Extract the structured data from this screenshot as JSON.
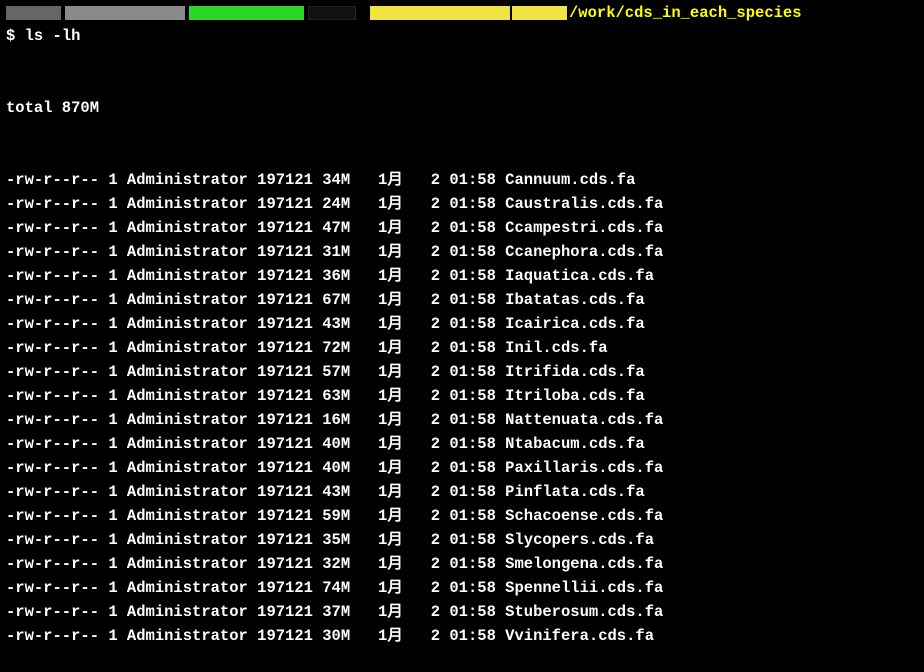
{
  "path_suffix": "/work/cds_in_each_species",
  "prompt": "$ ",
  "command": "ls -lh",
  "total_line": "total 870M",
  "columns": [
    "perms",
    "links",
    "owner",
    "group",
    "size",
    "month",
    "day",
    "time",
    "name"
  ],
  "rows": [
    {
      "perms": "-rw-r--r--",
      "links": "1",
      "owner": "Administrator",
      "group": "197121",
      "size": "34M",
      "month": "1月",
      "day": "2",
      "time": "01:58",
      "name": "Cannuum.cds.fa"
    },
    {
      "perms": "-rw-r--r--",
      "links": "1",
      "owner": "Administrator",
      "group": "197121",
      "size": "24M",
      "month": "1月",
      "day": "2",
      "time": "01:58",
      "name": "Caustralis.cds.fa"
    },
    {
      "perms": "-rw-r--r--",
      "links": "1",
      "owner": "Administrator",
      "group": "197121",
      "size": "47M",
      "month": "1月",
      "day": "2",
      "time": "01:58",
      "name": "Ccampestri.cds.fa"
    },
    {
      "perms": "-rw-r--r--",
      "links": "1",
      "owner": "Administrator",
      "group": "197121",
      "size": "31M",
      "month": "1月",
      "day": "2",
      "time": "01:58",
      "name": "Ccanephora.cds.fa"
    },
    {
      "perms": "-rw-r--r--",
      "links": "1",
      "owner": "Administrator",
      "group": "197121",
      "size": "36M",
      "month": "1月",
      "day": "2",
      "time": "01:58",
      "name": "Iaquatica.cds.fa"
    },
    {
      "perms": "-rw-r--r--",
      "links": "1",
      "owner": "Administrator",
      "group": "197121",
      "size": "67M",
      "month": "1月",
      "day": "2",
      "time": "01:58",
      "name": "Ibatatas.cds.fa"
    },
    {
      "perms": "-rw-r--r--",
      "links": "1",
      "owner": "Administrator",
      "group": "197121",
      "size": "43M",
      "month": "1月",
      "day": "2",
      "time": "01:58",
      "name": "Icairica.cds.fa"
    },
    {
      "perms": "-rw-r--r--",
      "links": "1",
      "owner": "Administrator",
      "group": "197121",
      "size": "72M",
      "month": "1月",
      "day": "2",
      "time": "01:58",
      "name": "Inil.cds.fa"
    },
    {
      "perms": "-rw-r--r--",
      "links": "1",
      "owner": "Administrator",
      "group": "197121",
      "size": "57M",
      "month": "1月",
      "day": "2",
      "time": "01:58",
      "name": "Itrifida.cds.fa"
    },
    {
      "perms": "-rw-r--r--",
      "links": "1",
      "owner": "Administrator",
      "group": "197121",
      "size": "63M",
      "month": "1月",
      "day": "2",
      "time": "01:58",
      "name": "Itriloba.cds.fa"
    },
    {
      "perms": "-rw-r--r--",
      "links": "1",
      "owner": "Administrator",
      "group": "197121",
      "size": "16M",
      "month": "1月",
      "day": "2",
      "time": "01:58",
      "name": "Nattenuata.cds.fa"
    },
    {
      "perms": "-rw-r--r--",
      "links": "1",
      "owner": "Administrator",
      "group": "197121",
      "size": "40M",
      "month": "1月",
      "day": "2",
      "time": "01:58",
      "name": "Ntabacum.cds.fa"
    },
    {
      "perms": "-rw-r--r--",
      "links": "1",
      "owner": "Administrator",
      "group": "197121",
      "size": "40M",
      "month": "1月",
      "day": "2",
      "time": "01:58",
      "name": "Paxillaris.cds.fa"
    },
    {
      "perms": "-rw-r--r--",
      "links": "1",
      "owner": "Administrator",
      "group": "197121",
      "size": "43M",
      "month": "1月",
      "day": "2",
      "time": "01:58",
      "name": "Pinflata.cds.fa"
    },
    {
      "perms": "-rw-r--r--",
      "links": "1",
      "owner": "Administrator",
      "group": "197121",
      "size": "59M",
      "month": "1月",
      "day": "2",
      "time": "01:58",
      "name": "Schacoense.cds.fa"
    },
    {
      "perms": "-rw-r--r--",
      "links": "1",
      "owner": "Administrator",
      "group": "197121",
      "size": "35M",
      "month": "1月",
      "day": "2",
      "time": "01:58",
      "name": "Slycopers.cds.fa"
    },
    {
      "perms": "-rw-r--r--",
      "links": "1",
      "owner": "Administrator",
      "group": "197121",
      "size": "32M",
      "month": "1月",
      "day": "2",
      "time": "01:58",
      "name": "Smelongena.cds.fa"
    },
    {
      "perms": "-rw-r--r--",
      "links": "1",
      "owner": "Administrator",
      "group": "197121",
      "size": "74M",
      "month": "1月",
      "day": "2",
      "time": "01:58",
      "name": "Spennellii.cds.fa"
    },
    {
      "perms": "-rw-r--r--",
      "links": "1",
      "owner": "Administrator",
      "group": "197121",
      "size": "37M",
      "month": "1月",
      "day": "2",
      "time": "01:58",
      "name": "Stuberosum.cds.fa"
    },
    {
      "perms": "-rw-r--r--",
      "links": "1",
      "owner": "Administrator",
      "group": "197121",
      "size": "30M",
      "month": "1月",
      "day": "2",
      "time": "01:58",
      "name": "Vvinifera.cds.fa"
    }
  ]
}
